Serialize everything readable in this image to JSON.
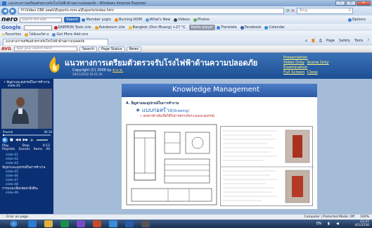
{
  "window": {
    "title": "แนวทางการเตรียมตัวตรวจรับโรงไฟฟ้าด้านความปลอดภัย - Windows Internet Explorer",
    "min_label": "–",
    "max_label": "▭",
    "close_label": "x"
  },
  "address_bar": {
    "url": "H:\\Video CBK sawk\\Exports-mm-a\\Exports\\index.htm",
    "search_engine": "Bing",
    "search_icon": "magnifier-icon"
  },
  "nero_toolbar": {
    "logo": "nero",
    "search_placeholder": "Search the web",
    "search_button": "Search",
    "items": [
      "Member Login",
      "Burning ROM",
      "What's New",
      "Videos",
      "Photos"
    ],
    "options": "Options"
  },
  "google_toolbar": {
    "logo": "Google",
    "items": [
      "DAEMON Tools Lite",
      "Autobourn Lite",
      "Bangkok (Don Muang) +27 °C",
      "Radio player",
      "Translate",
      "Facebook",
      "Calendar"
    ]
  },
  "favorites_bar": {
    "favorites": "Favorites",
    "link1": "โฟล์เดอร์ต่าง",
    "link2": "Get More Add-ons"
  },
  "tab_bar": {
    "tab_title": "แนวทางการเตรียมตัวตรวจรับโรงไฟฟ้าด้านความปลอดภัย",
    "commands": [
      "Page",
      "Safety",
      "Tools"
    ]
  },
  "avg_toolbar": {
    "logo": "AVG",
    "search_placeholder": "Type your search here!",
    "search_button": "Search",
    "page_status": "Page Status",
    "news": "News"
  },
  "banner": {
    "title": "แนวทางการเตรียมตัวตรวจรับโรงไฟฟ้าด้านความปลอดภัย",
    "copyright_prefix": "Copyright (C) 2009 by",
    "copyright_owner": "ทาง ท.",
    "date": "29/11/2552 20:21:34",
    "links_row1": "Presentation",
    "links_row2a": "Video Only",
    "links_row2b": "Scene Only",
    "links_row3": "Examination",
    "links_row4a": "Full Screen",
    "links_row4b": "Close"
  },
  "left_panel": {
    "heading": "• ปัญหาและอุปกรณ์ในการทำงาน",
    "heading2": "slide-45",
    "video_state": "Paused",
    "video_time": "00:18",
    "progress": 0.03,
    "controls_time": "0:12",
    "playlist_cols": [
      "Play",
      "Stop",
      "0:12"
    ],
    "playlist_cols2": [
      "Playlists",
      "Scenes",
      "Items",
      "All"
    ],
    "playlist": [
      {
        "label": "slide-41",
        "section": false
      },
      {
        "label": "slide-42",
        "section": false
      },
      {
        "label": "slide-43",
        "section": false
      },
      {
        "label": "ปัญหาและอุปกรณ์ในการทำงาน",
        "section": true
      },
      {
        "label": "slide-45",
        "section": false
      },
      {
        "label": "slide-46",
        "section": false
      },
      {
        "label": "slide-47",
        "section": false
      },
      {
        "label": "slide-48",
        "section": false
      },
      {
        "label": "การแบบ/เลือกจัดหาสิ่งที่จะ",
        "section": true
      },
      {
        "label": "slide-49",
        "section": false
      }
    ]
  },
  "slide": {
    "title": "Knowledge Management",
    "heading": "4. ปัญหาและอุปกรณ์ในการทำงาน",
    "sub_thai": "แบบก่อสร้าง",
    "sub_en": "(Drawing)",
    "bullet": "• เอกสารอ้างอิงเพื่อใช้ในการตรวจรับระบบและอุปกรณ์"
  },
  "status_bar": {
    "left": "Error on page.",
    "zone": "Computer | Protected Mode: Off",
    "zoom": "100%"
  },
  "taskbar": {
    "time": "23:47",
    "date": "4/1/2556",
    "lang": "EN"
  },
  "colors": {
    "banner": "#2a5fa5",
    "left_panel": "#0b2f73",
    "slide_bar": "#3c6cb8",
    "link": "#fff87a"
  }
}
